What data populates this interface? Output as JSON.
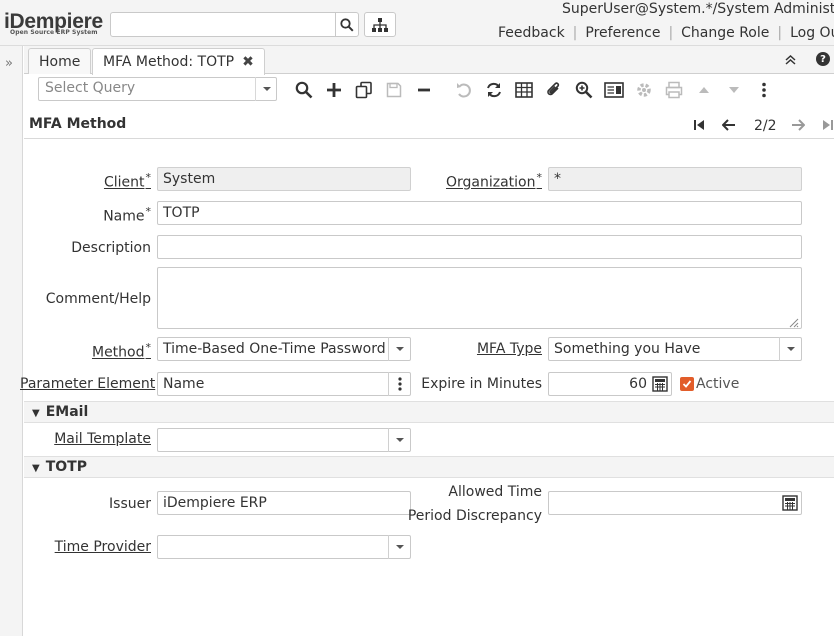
{
  "app": {
    "logo": "iDempiere",
    "logo_sub": "Open Source ERP System",
    "search_placeholder": ""
  },
  "user": {
    "info": "SuperUser@System.*/System Administrator",
    "links": [
      "Feedback",
      "Preference",
      "Change Role",
      "Log Out"
    ]
  },
  "tabs": [
    {
      "label": "Home",
      "active": false
    },
    {
      "label": "MFA Method: TOTP",
      "active": true
    }
  ],
  "toolbar": {
    "query_placeholder": "Select Query",
    "icons": [
      "search-icon",
      "new-record-icon",
      "copy-icon",
      "save-icon",
      "delete-icon",
      "undo-icon",
      "refresh-icon",
      "grid-toggle-icon",
      "attachment-icon",
      "zoom-icon",
      "report-icon",
      "process-icon",
      "print-icon",
      "parent-icon",
      "detail-icon",
      "more-icon"
    ]
  },
  "form": {
    "title": "MFA Method",
    "record_count": "2/2",
    "client_label": "Client",
    "client_value": "System",
    "org_label": "Organization",
    "org_value": "*",
    "name_label": "Name",
    "name_value": "TOTP",
    "description_label": "Description",
    "description_value": "",
    "comment_label": "Comment/Help",
    "comment_value": "",
    "method_label": "Method",
    "method_value": "Time-Based One-Time Password",
    "mfa_type_label": "MFA Type",
    "mfa_type_value": "Something you Have",
    "param_label": "Parameter Element",
    "param_value": "Name",
    "expire_label": "Expire in Minutes",
    "expire_value": "60",
    "active_label": "Active",
    "active_checked": true
  },
  "sections": {
    "email": {
      "title": "EMail",
      "mail_template_label": "Mail Template",
      "mail_template_value": ""
    },
    "totp": {
      "title": "TOTP",
      "issuer_label": "Issuer",
      "issuer_value": "iDempiere ERP",
      "allowed_time_label_1": "Allowed Time",
      "allowed_time_label_2": "Period Discrepancy",
      "allowed_time_value": "",
      "time_provider_label": "Time Provider",
      "time_provider_value": ""
    }
  },
  "colors": {
    "accent": "#e25d2a",
    "header_bg": "#f4f4f4",
    "readonly_bg": "#efefef"
  }
}
